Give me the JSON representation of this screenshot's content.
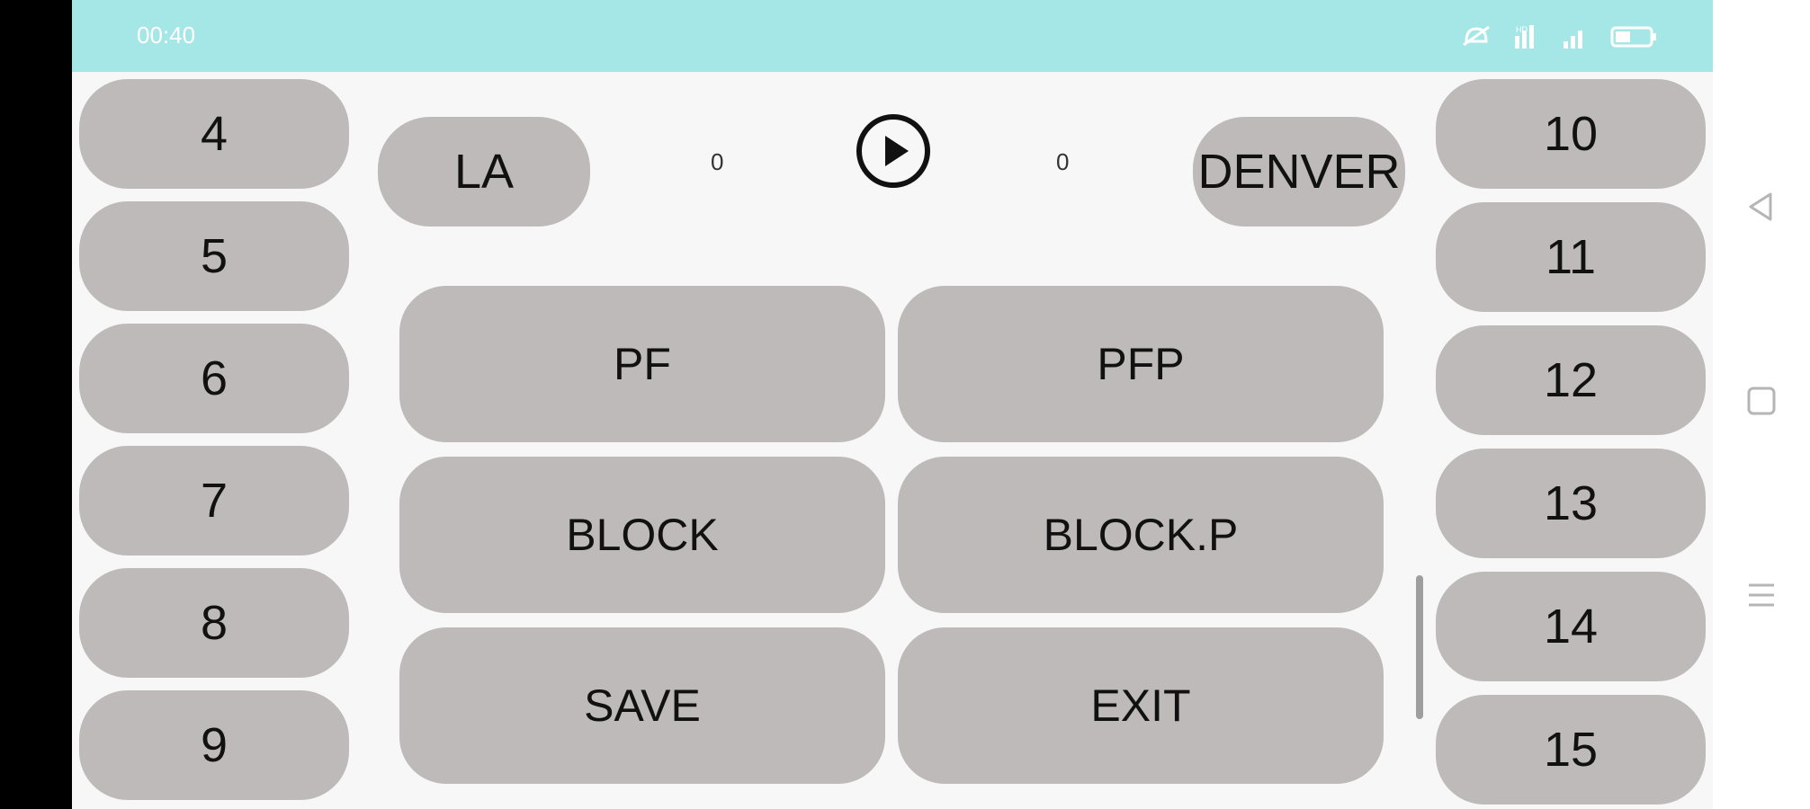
{
  "status_bar": {
    "time": "00:40",
    "icons": [
      "do-not-disturb-icon",
      "data-signal-icon",
      "cell-signal-icon",
      "battery-icon"
    ]
  },
  "scoreboard": {
    "home_team": "LA",
    "home_score": "0",
    "away_team": "DENVER",
    "away_score": "0",
    "play_icon": "play-circle-icon"
  },
  "left_numbers": [
    "4",
    "5",
    "6",
    "7",
    "8",
    "9"
  ],
  "right_numbers": [
    "10",
    "11",
    "12",
    "13",
    "14",
    "15"
  ],
  "actions": {
    "pf": "PF",
    "pfp": "PFP",
    "block": "BLOCK",
    "block_p": "BLOCK.P",
    "save": "SAVE",
    "exit": "EXIT"
  },
  "nav_bar": {
    "icons": [
      "back-icon",
      "home-icon",
      "menu-icon"
    ]
  },
  "colors": {
    "status_bar": "#a5e7e6",
    "button": "#bdbab9",
    "background": "#f7f7f7"
  }
}
